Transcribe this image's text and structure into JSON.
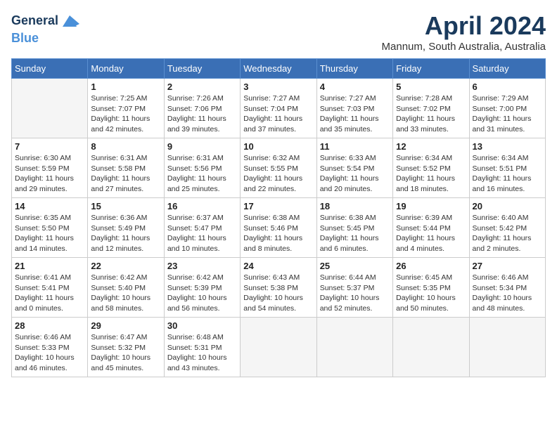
{
  "header": {
    "logo_line1": "General",
    "logo_line2": "Blue",
    "month": "April 2024",
    "location": "Mannum, South Australia, Australia"
  },
  "days_of_week": [
    "Sunday",
    "Monday",
    "Tuesday",
    "Wednesday",
    "Thursday",
    "Friday",
    "Saturday"
  ],
  "weeks": [
    [
      {
        "day": "",
        "empty": true
      },
      {
        "day": "1",
        "sunrise": "7:25 AM",
        "sunset": "7:07 PM",
        "daylight": "11 hours and 42 minutes."
      },
      {
        "day": "2",
        "sunrise": "7:26 AM",
        "sunset": "7:06 PM",
        "daylight": "11 hours and 39 minutes."
      },
      {
        "day": "3",
        "sunrise": "7:27 AM",
        "sunset": "7:04 PM",
        "daylight": "11 hours and 37 minutes."
      },
      {
        "day": "4",
        "sunrise": "7:27 AM",
        "sunset": "7:03 PM",
        "daylight": "11 hours and 35 minutes."
      },
      {
        "day": "5",
        "sunrise": "7:28 AM",
        "sunset": "7:02 PM",
        "daylight": "11 hours and 33 minutes."
      },
      {
        "day": "6",
        "sunrise": "7:29 AM",
        "sunset": "7:00 PM",
        "daylight": "11 hours and 31 minutes."
      }
    ],
    [
      {
        "day": "7",
        "sunrise": "6:30 AM",
        "sunset": "5:59 PM",
        "daylight": "11 hours and 29 minutes."
      },
      {
        "day": "8",
        "sunrise": "6:31 AM",
        "sunset": "5:58 PM",
        "daylight": "11 hours and 27 minutes."
      },
      {
        "day": "9",
        "sunrise": "6:31 AM",
        "sunset": "5:56 PM",
        "daylight": "11 hours and 25 minutes."
      },
      {
        "day": "10",
        "sunrise": "6:32 AM",
        "sunset": "5:55 PM",
        "daylight": "11 hours and 22 minutes."
      },
      {
        "day": "11",
        "sunrise": "6:33 AM",
        "sunset": "5:54 PM",
        "daylight": "11 hours and 20 minutes."
      },
      {
        "day": "12",
        "sunrise": "6:34 AM",
        "sunset": "5:52 PM",
        "daylight": "11 hours and 18 minutes."
      },
      {
        "day": "13",
        "sunrise": "6:34 AM",
        "sunset": "5:51 PM",
        "daylight": "11 hours and 16 minutes."
      }
    ],
    [
      {
        "day": "14",
        "sunrise": "6:35 AM",
        "sunset": "5:50 PM",
        "daylight": "11 hours and 14 minutes."
      },
      {
        "day": "15",
        "sunrise": "6:36 AM",
        "sunset": "5:49 PM",
        "daylight": "11 hours and 12 minutes."
      },
      {
        "day": "16",
        "sunrise": "6:37 AM",
        "sunset": "5:47 PM",
        "daylight": "11 hours and 10 minutes."
      },
      {
        "day": "17",
        "sunrise": "6:38 AM",
        "sunset": "5:46 PM",
        "daylight": "11 hours and 8 minutes."
      },
      {
        "day": "18",
        "sunrise": "6:38 AM",
        "sunset": "5:45 PM",
        "daylight": "11 hours and 6 minutes."
      },
      {
        "day": "19",
        "sunrise": "6:39 AM",
        "sunset": "5:44 PM",
        "daylight": "11 hours and 4 minutes."
      },
      {
        "day": "20",
        "sunrise": "6:40 AM",
        "sunset": "5:42 PM",
        "daylight": "11 hours and 2 minutes."
      }
    ],
    [
      {
        "day": "21",
        "sunrise": "6:41 AM",
        "sunset": "5:41 PM",
        "daylight": "11 hours and 0 minutes."
      },
      {
        "day": "22",
        "sunrise": "6:42 AM",
        "sunset": "5:40 PM",
        "daylight": "10 hours and 58 minutes."
      },
      {
        "day": "23",
        "sunrise": "6:42 AM",
        "sunset": "5:39 PM",
        "daylight": "10 hours and 56 minutes."
      },
      {
        "day": "24",
        "sunrise": "6:43 AM",
        "sunset": "5:38 PM",
        "daylight": "10 hours and 54 minutes."
      },
      {
        "day": "25",
        "sunrise": "6:44 AM",
        "sunset": "5:37 PM",
        "daylight": "10 hours and 52 minutes."
      },
      {
        "day": "26",
        "sunrise": "6:45 AM",
        "sunset": "5:35 PM",
        "daylight": "10 hours and 50 minutes."
      },
      {
        "day": "27",
        "sunrise": "6:46 AM",
        "sunset": "5:34 PM",
        "daylight": "10 hours and 48 minutes."
      }
    ],
    [
      {
        "day": "28",
        "sunrise": "6:46 AM",
        "sunset": "5:33 PM",
        "daylight": "10 hours and 46 minutes."
      },
      {
        "day": "29",
        "sunrise": "6:47 AM",
        "sunset": "5:32 PM",
        "daylight": "10 hours and 45 minutes."
      },
      {
        "day": "30",
        "sunrise": "6:48 AM",
        "sunset": "5:31 PM",
        "daylight": "10 hours and 43 minutes."
      },
      {
        "day": "",
        "empty": true
      },
      {
        "day": "",
        "empty": true
      },
      {
        "day": "",
        "empty": true
      },
      {
        "day": "",
        "empty": true
      }
    ]
  ]
}
